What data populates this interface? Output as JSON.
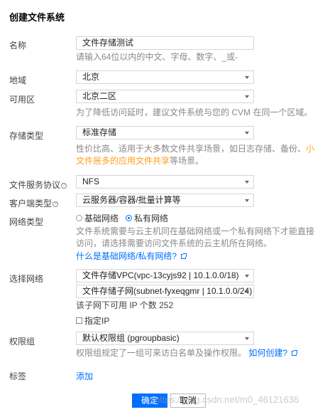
{
  "dialog": {
    "title": "创建文件系统"
  },
  "name": {
    "label": "名称",
    "value": "文件存储测试",
    "hint": "请输入64位以内的中文、字母、数字、_或-"
  },
  "region": {
    "label": "地域",
    "value": "北京"
  },
  "zone": {
    "label": "可用区",
    "value": "北京二区",
    "hint": "为了降低访问延时，建议文件系统与您的 CVM 在同一个区域。"
  },
  "storage_type": {
    "label": "存储类型",
    "value": "标准存储",
    "hint_part1": "性价比高、适用于大多数文件共享场景，如日志存储、备份、",
    "hint_highlight": "小文件居多的应用文件共享",
    "hint_part2": "等场景。"
  },
  "protocol": {
    "label": "文件服务协议",
    "value": "NFS"
  },
  "client_type": {
    "label": "客户端类型",
    "value": "云服务器/容器/批量计算等"
  },
  "network_type": {
    "label": "网络类型",
    "options": [
      "基础网络",
      "私有网络"
    ],
    "selected": "私有网络",
    "hint": "文件系统需要与云主机同在基础网络或一个私有网络下才能直接访问，请选择需要访问文件系统的云主机所在网络。",
    "link": "什么是基础网络/私有网络?"
  },
  "network_select": {
    "label": "选择网络",
    "vpc_value": "文件存储VPC(vpc-13cyjs92 | 10.1.0.0/18)",
    "subnet_value": "文件存储子网(subnet-fyxeqgmr | 10.1.0.0/24)",
    "ip_info": "该子网下可用 IP 个数 252",
    "specify_ip_label": "指定IP"
  },
  "permission_group": {
    "label": "权限组",
    "value": "默认权限组 (pgroupbasic)",
    "hint": "权限组规定了一组可来访白名单及操作权限。",
    "link": "如何创建?"
  },
  "tags": {
    "label": "标签",
    "add_link": "添加"
  },
  "footer": {
    "confirm_label": "确定",
    "cancel_label": "取消"
  },
  "watermark": "https://blog.csdn.net/m0_46121636",
  "colors": {
    "primary": "#006eff",
    "highlight": "#ff9c19",
    "hint": "#888888"
  }
}
